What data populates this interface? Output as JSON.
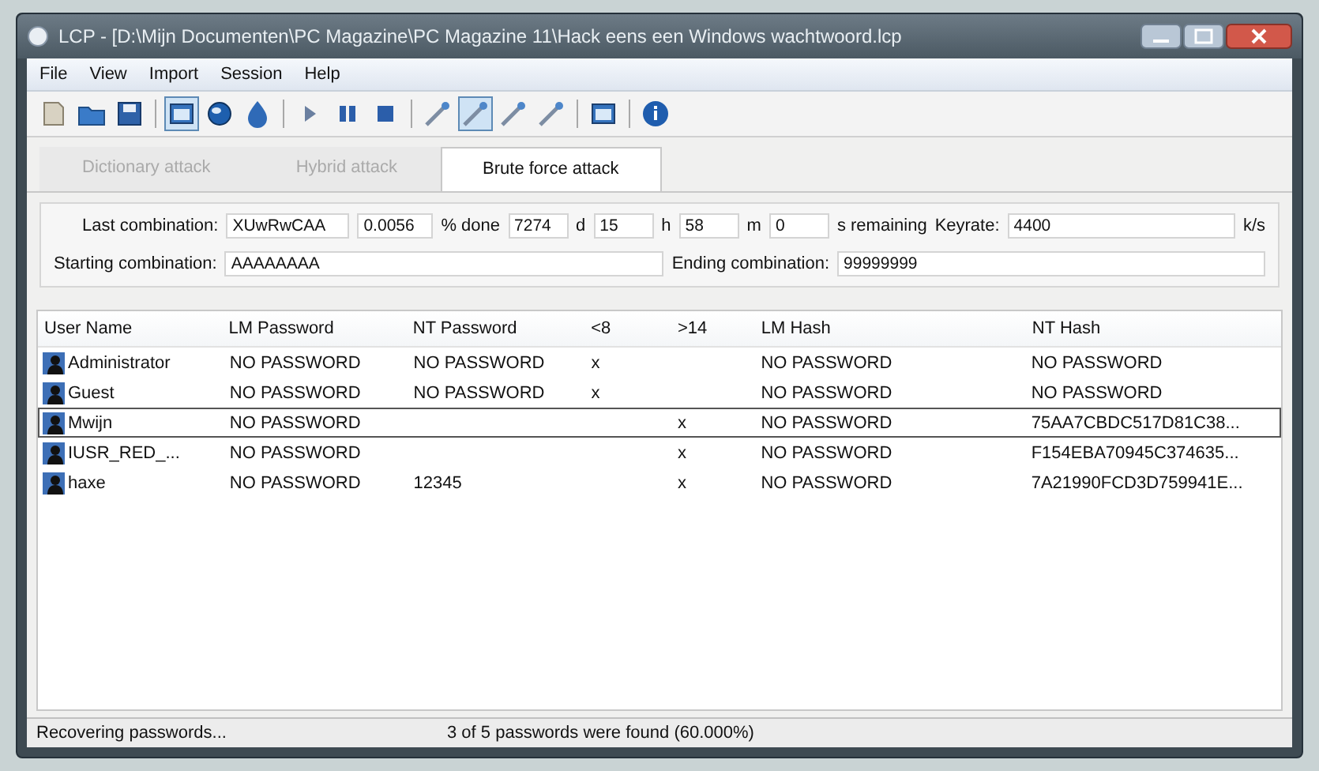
{
  "window": {
    "title": "LCP - [D:\\Mijn Documenten\\PC Magazine\\PC Magazine 11\\Hack eens een Windows wachtwoord.lcp"
  },
  "menu": [
    "File",
    "View",
    "Import",
    "Session",
    "Help"
  ],
  "toolbar": [
    {
      "kind": "import",
      "pressed": false
    },
    {
      "kind": "open",
      "pressed": false
    },
    {
      "kind": "save",
      "pressed": false
    },
    {
      "kind": "sep"
    },
    {
      "kind": "window",
      "pressed": true
    },
    {
      "kind": "globe",
      "pressed": false
    },
    {
      "kind": "drop",
      "pressed": false
    },
    {
      "kind": "sep"
    },
    {
      "kind": "play",
      "pressed": false
    },
    {
      "kind": "pause",
      "pressed": false
    },
    {
      "kind": "stop",
      "pressed": false
    },
    {
      "kind": "sep"
    },
    {
      "kind": "wand",
      "pressed": false
    },
    {
      "kind": "wand",
      "pressed": true
    },
    {
      "kind": "wand",
      "pressed": false
    },
    {
      "kind": "wand",
      "pressed": false
    },
    {
      "kind": "sep"
    },
    {
      "kind": "window",
      "pressed": false
    },
    {
      "kind": "sep"
    },
    {
      "kind": "info",
      "pressed": false
    }
  ],
  "tabs": [
    {
      "label": "Dictionary attack",
      "selected": false,
      "disabled": true
    },
    {
      "label": "Hybrid attack",
      "selected": false,
      "disabled": true
    },
    {
      "label": "Brute force attack",
      "selected": true,
      "disabled": false
    }
  ],
  "progress": {
    "last_label": "Last combination:",
    "last": "XUwRwCAA",
    "rate": "0.0056",
    "done_label": "% done",
    "done": "7274",
    "d_label": "d",
    "d": "15",
    "h_label": "h",
    "h": "58",
    "m_label": "m",
    "m": "0",
    "remaining_label": "s remaining",
    "keyrate_label": "Keyrate:",
    "keyrate": "4400",
    "keyrate_unit": "k/s",
    "start_label": "Starting combination:",
    "start": "AAAAAAAA",
    "end_label": "Ending combination:",
    "end": "99999999"
  },
  "table": {
    "columns": [
      "User Name",
      "LM Password",
      "NT Password",
      "<8",
      ">14",
      "LM Hash",
      "NT Hash"
    ],
    "rows": [
      {
        "cells": [
          "Administrator",
          "NO PASSWORD",
          "NO PASSWORD",
          "x",
          null,
          "NO PASSWORD",
          "NO PASSWORD"
        ],
        "selected": false
      },
      {
        "cells": [
          "Guest",
          "NO PASSWORD",
          "NO PASSWORD",
          "x",
          null,
          "NO PASSWORD",
          "NO PASSWORD"
        ],
        "selected": false
      },
      {
        "cells": [
          "Mwijn",
          "NO PASSWORD",
          null,
          null,
          "x",
          "NO PASSWORD",
          "75AA7CBDC517D81C38..."
        ],
        "selected": true
      },
      {
        "cells": [
          "IUSR_RED_...",
          "NO PASSWORD",
          null,
          null,
          "x",
          "NO PASSWORD",
          "F154EBA70945C374635..."
        ],
        "selected": false
      },
      {
        "cells": [
          "haxe",
          "NO PASSWORD",
          "12345",
          null,
          "x",
          "NO PASSWORD",
          "7A21990FCD3D759941E..."
        ],
        "selected": false
      }
    ]
  },
  "status_bar": [
    "Recovering passwords...",
    "3 of 5 passwords were found (60.000%)"
  ]
}
